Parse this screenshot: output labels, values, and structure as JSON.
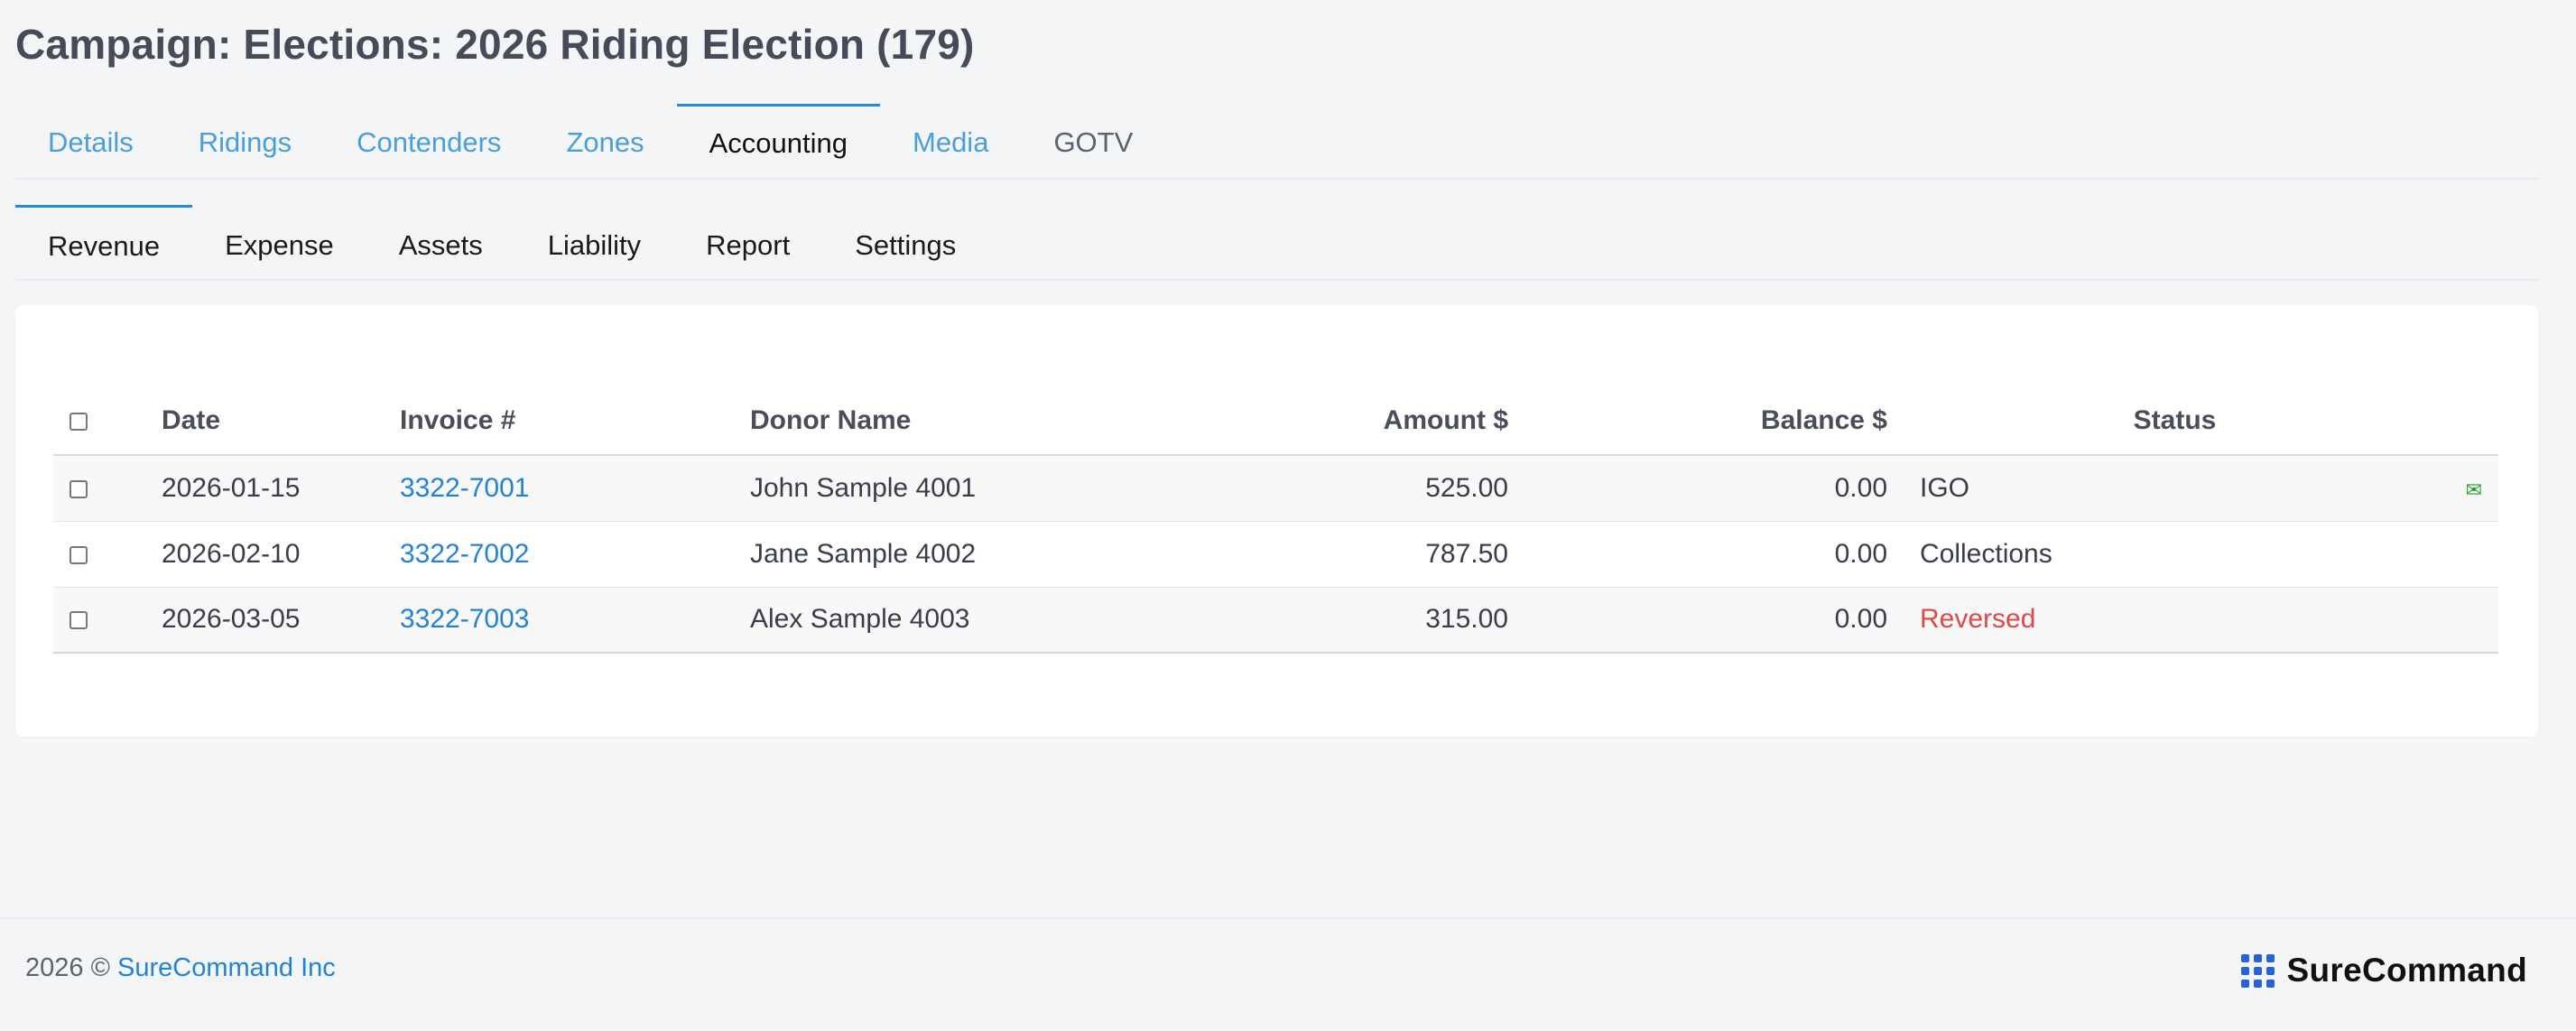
{
  "page": {
    "title": "Campaign: Elections: 2026 Riding Election (179)"
  },
  "main_tabs": [
    {
      "label": "Details",
      "state": "link"
    },
    {
      "label": "Ridings",
      "state": "link"
    },
    {
      "label": "Contenders",
      "state": "link"
    },
    {
      "label": "Zones",
      "state": "link"
    },
    {
      "label": "Accounting",
      "state": "active"
    },
    {
      "label": "Media",
      "state": "link"
    },
    {
      "label": "GOTV",
      "state": "plain"
    }
  ],
  "sub_tabs": [
    {
      "label": "Revenue",
      "state": "active"
    },
    {
      "label": "Expense",
      "state": "plain"
    },
    {
      "label": "Assets",
      "state": "plain"
    },
    {
      "label": "Liability",
      "state": "plain"
    },
    {
      "label": "Report",
      "state": "plain"
    },
    {
      "label": "Settings",
      "state": "plain"
    }
  ],
  "table": {
    "headers": {
      "date": "Date",
      "invoice": "Invoice #",
      "donor": "Donor Name",
      "amount": "Amount $",
      "balance": "Balance $",
      "status": "Status"
    },
    "rows": [
      {
        "date": "2026-01-15",
        "invoice": "3322-7001",
        "donor": "John Sample 4001",
        "amount": "525.00",
        "balance": "0.00",
        "status": "IGO",
        "status_color": "#3a3d4a",
        "mail_icon": "envelope-icon"
      },
      {
        "date": "2026-02-10",
        "invoice": "3322-7002",
        "donor": "Jane Sample 4002",
        "amount": "787.50",
        "balance": "0.00",
        "status": "Collections",
        "status_color": "#3a3d4a",
        "mail_icon": ""
      },
      {
        "date": "2026-03-05",
        "invoice": "3322-7003",
        "donor": "Alex Sample 4003",
        "amount": "315.00",
        "balance": "0.00",
        "status": "Reversed",
        "status_color": "#e04848",
        "mail_icon": ""
      }
    ]
  },
  "footer": {
    "copyright": "2026 © ",
    "company_link": "SureCommand Inc",
    "brand_name": "SureCommand",
    "brand_icon": "grid-dots-icon"
  },
  "colors": {
    "link": "#4a9fd8",
    "accent": "#2b8ad6",
    "invoice_link": "#2383d3",
    "reversed": "#e04848",
    "mail_icon": "#22a02a",
    "brand_grid": "#2762d6"
  }
}
